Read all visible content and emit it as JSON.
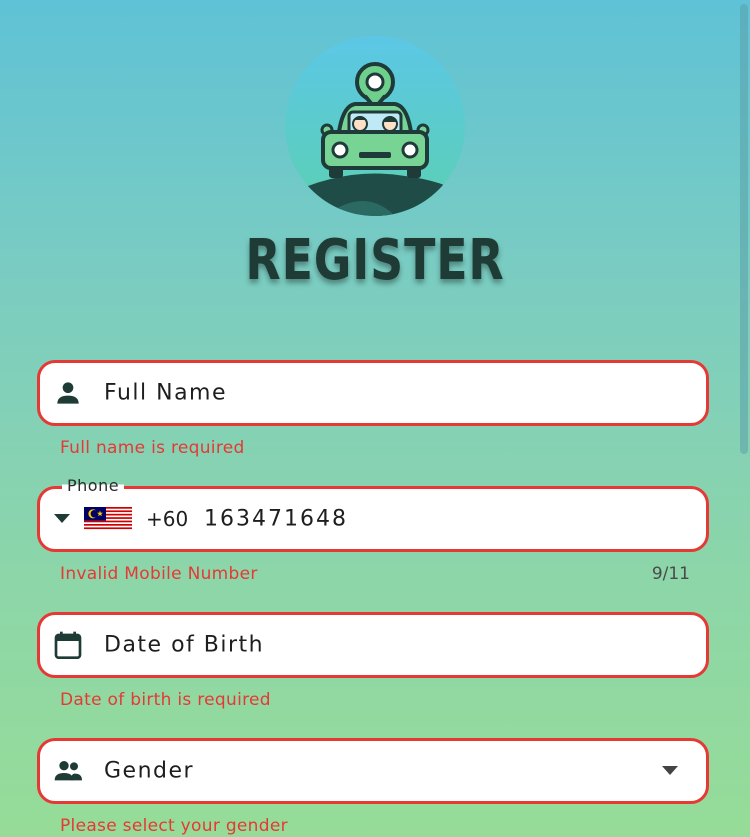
{
  "title": "REGISTER",
  "fields": {
    "full_name": {
      "placeholder": "Full Name",
      "error": "Full name is required",
      "icon": "person-icon"
    },
    "phone": {
      "label": "Phone",
      "country_flag": "malaysia-flag-icon",
      "dial_code": "+60",
      "value": "163471648",
      "error": "Invalid Mobile Number",
      "counter": "9/11"
    },
    "dob": {
      "placeholder": "Date of Birth",
      "error": "Date of birth is required",
      "icon": "calendar-icon"
    },
    "gender": {
      "placeholder": "Gender",
      "error": "Please select your gender",
      "icon": "people-icon"
    }
  },
  "colors": {
    "error": "#e53935",
    "title": "#1f3b35",
    "icon": "#1f3b35",
    "field_bg": "#ffffff"
  }
}
